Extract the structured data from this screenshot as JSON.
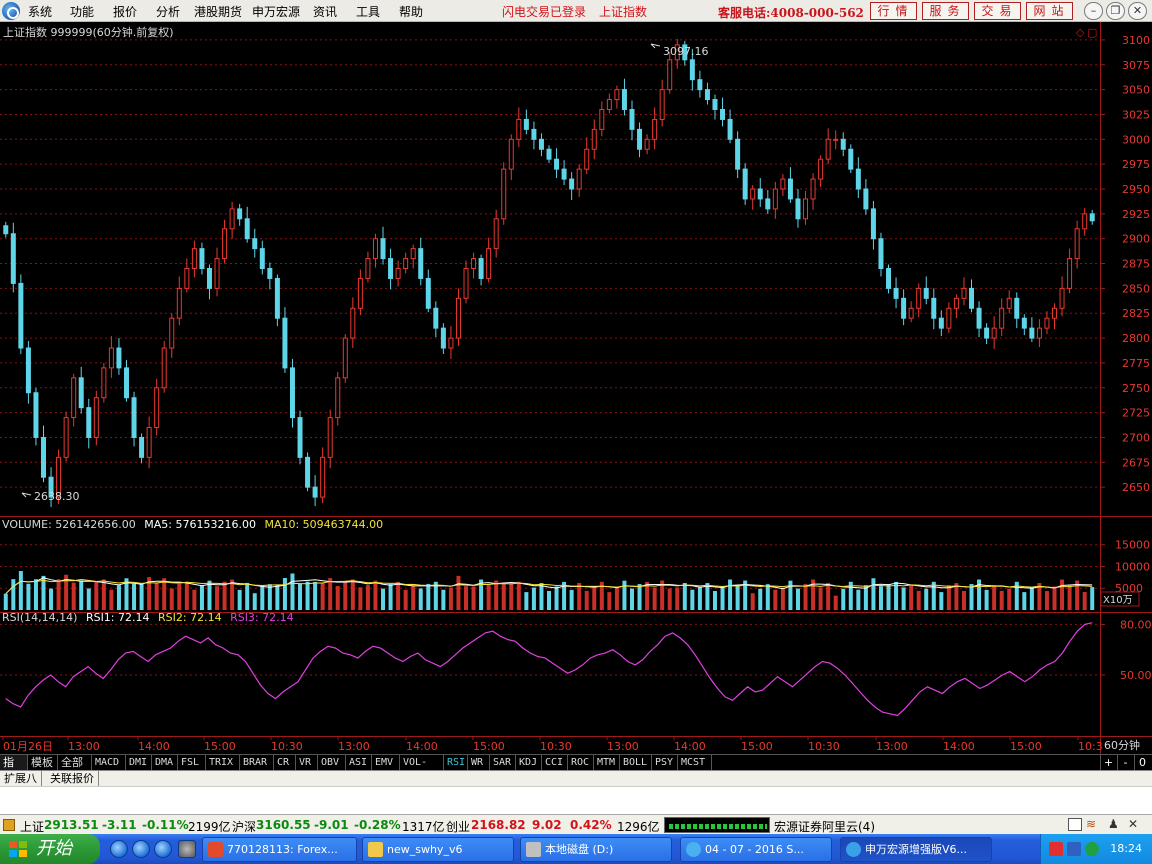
{
  "menu": {
    "items": [
      "系统",
      "功能",
      "报价",
      "分析",
      "港股期货",
      "申万宏源",
      "资讯",
      "工具",
      "帮助"
    ],
    "status_login": "闪电交易已登录",
    "status_index": "上证指数",
    "hotline": "客服电话:4008-000-562",
    "buttons": [
      "行情",
      "服务",
      "交易",
      "网站"
    ]
  },
  "chart": {
    "title": "上证指数 999999(60分钟.前复权)",
    "high_label": "3097.16",
    "low_label": "2638.30",
    "price_ticks": [
      "3100",
      "3075",
      "3050",
      "3025",
      "3000",
      "2975",
      "2950",
      "2925",
      "2900",
      "2875",
      "2850",
      "2825",
      "2800",
      "2775",
      "2750",
      "2725",
      "2700",
      "2675",
      "2650"
    ],
    "volume_legend": {
      "volume": "VOLUME: 526142656.00",
      "ma5": "MA5: 576153216.00",
      "ma10": "MA10: 509463744.00"
    },
    "volume_ticks": [
      "15000",
      "10000",
      "5000"
    ],
    "volume_unit": "X10万",
    "rsi_legend": {
      "params": "RSI(14,14,14)",
      "rsi1": "RSI1: 72.14",
      "rsi2": "RSI2: 72.14",
      "rsi3": "RSI3: 72.14"
    },
    "rsi_ticks": [
      "80.00",
      "50.00"
    ],
    "time_labels": [
      "01月26日",
      "13:00",
      "14:00",
      "15:00",
      "10:30",
      "13:00",
      "14:00",
      "15:00",
      "10:30",
      "13:00",
      "14:00",
      "15:00",
      "10:30",
      "13:00",
      "14:00",
      "15:00",
      "10:3"
    ],
    "period": "60分钟",
    "colors": {
      "up": "#e8392f",
      "down": "#5fd5e8",
      "grid": "#8a1212",
      "rsi": "#e040e0",
      "ma5": "#ffffff",
      "ma10": "#f2e23a"
    }
  },
  "chart_data": {
    "type": "candlestick",
    "title": "上证指数 999999(60分钟.前复权)",
    "ylim": [
      2625,
      3112
    ],
    "annotations": [
      {
        "label": "3097.16",
        "value": 3097.16
      },
      {
        "label": "2638.30",
        "value": 2638.3
      }
    ],
    "close": [
      2905,
      2855,
      2790,
      2745,
      2700,
      2660,
      2640,
      2680,
      2720,
      2760,
      2730,
      2700,
      2740,
      2770,
      2790,
      2770,
      2740,
      2700,
      2680,
      2710,
      2750,
      2790,
      2820,
      2850,
      2870,
      2890,
      2870,
      2850,
      2880,
      2910,
      2930,
      2920,
      2900,
      2890,
      2870,
      2860,
      2820,
      2770,
      2720,
      2680,
      2650,
      2640,
      2680,
      2720,
      2760,
      2800,
      2830,
      2860,
      2880,
      2900,
      2880,
      2860,
      2870,
      2880,
      2890,
      2860,
      2830,
      2810,
      2790,
      2800,
      2840,
      2870,
      2880,
      2860,
      2890,
      2920,
      2970,
      3000,
      3020,
      3010,
      3000,
      2990,
      2980,
      2970,
      2960,
      2950,
      2970,
      2990,
      3010,
      3030,
      3040,
      3050,
      3030,
      3010,
      2990,
      3000,
      3020,
      3050,
      3080,
      3095,
      3080,
      3060,
      3050,
      3040,
      3030,
      3020,
      3000,
      2970,
      2940,
      2950,
      2940,
      2930,
      2950,
      2960,
      2940,
      2920,
      2940,
      2960,
      2980,
      3000,
      3000,
      2990,
      2970,
      2950,
      2930,
      2900,
      2870,
      2850,
      2840,
      2820,
      2830,
      2850,
      2840,
      2820,
      2810,
      2830,
      2840,
      2850,
      2830,
      2810,
      2800,
      2810,
      2830,
      2840,
      2820,
      2810,
      2800,
      2810,
      2820,
      2830,
      2850,
      2880,
      2910,
      2925,
      2918
    ],
    "volume_scale": "X10万",
    "volume_ylim": [
      0,
      17000
    ],
    "volume_ticks": [
      5000,
      10000,
      15000
    ],
    "volume_last": 5261.42656,
    "ma5_last": 5761.53216,
    "ma10_last": 5094.63744,
    "rsi": {
      "params": [
        14,
        14,
        14
      ],
      "ylim": [
        15,
        85
      ],
      "last": 72.14
    },
    "rsi_values": [
      36,
      33,
      31,
      38,
      43,
      47,
      50,
      46,
      43,
      49,
      52,
      55,
      51,
      48,
      53,
      59,
      63,
      64,
      61,
      58,
      62,
      64,
      66,
      70,
      73,
      71,
      69,
      72,
      68,
      66,
      63,
      62,
      58,
      51,
      44,
      39,
      36,
      40,
      43,
      46,
      53,
      60,
      64,
      67,
      66,
      63,
      62,
      60,
      64,
      67,
      66,
      63,
      60,
      58,
      61,
      63,
      59,
      57,
      55,
      58,
      62,
      66,
      69,
      72,
      75,
      76,
      73,
      71,
      70,
      66,
      63,
      61,
      60,
      57,
      54,
      51,
      53,
      56,
      60,
      62,
      63,
      65,
      62,
      58,
      56,
      59,
      64,
      68,
      73,
      75,
      72,
      68,
      62,
      55,
      48,
      42,
      37,
      35,
      39,
      43,
      40,
      41,
      45,
      49,
      46,
      43,
      47,
      51,
      55,
      58,
      57,
      54,
      50,
      45,
      40,
      35,
      31,
      28,
      27,
      26,
      30,
      35,
      40,
      43,
      41,
      39,
      43,
      46,
      48,
      45,
      42,
      44,
      47,
      50,
      52,
      49,
      46,
      49,
      53,
      56,
      58,
      63,
      70,
      76,
      80,
      81
    ]
  },
  "tabs": [
    "指标",
    "模板",
    "全部",
    "MACD",
    "DMI",
    "DMA",
    "FSL",
    "TRIX",
    "BRAR",
    "CR",
    "VR",
    "OBV",
    "ASI",
    "EMV",
    "VOL-TDX",
    "RSI",
    "WR",
    "SAR",
    "KDJ",
    "CCI",
    "ROC",
    "MTM",
    "BOLL",
    "PSY",
    "MCST"
  ],
  "tab_controls": [
    "+",
    "-",
    "0"
  ],
  "ext_tabs": [
    "扩展八",
    "关联报价"
  ],
  "quote": {
    "sh_name": "上证",
    "sh_val": "2913.51",
    "sh_chg": "-3.11",
    "sh_pct": "-0.11%",
    "sh_amt": "2199亿",
    "hs_name": "沪深",
    "hs_val": "3160.55",
    "hs_chg": "-9.01",
    "hs_pct": "-0.28%",
    "hs_amt": "1317亿",
    "cy_name": "创业",
    "cy_val": "2168.82",
    "cy_chg": "9.02",
    "cy_pct": "0.42%",
    "cy_amt": "1296亿",
    "server": "宏源证券阿里云(4)"
  },
  "taskbar": {
    "start": "开始",
    "tasks": [
      "770128113: Forex...",
      "new_swhy_v6",
      "本地磁盘 (D:)",
      "04 - 07 - 2016 S...",
      "申万宏源增强版V6..."
    ],
    "clock": "18:24"
  }
}
